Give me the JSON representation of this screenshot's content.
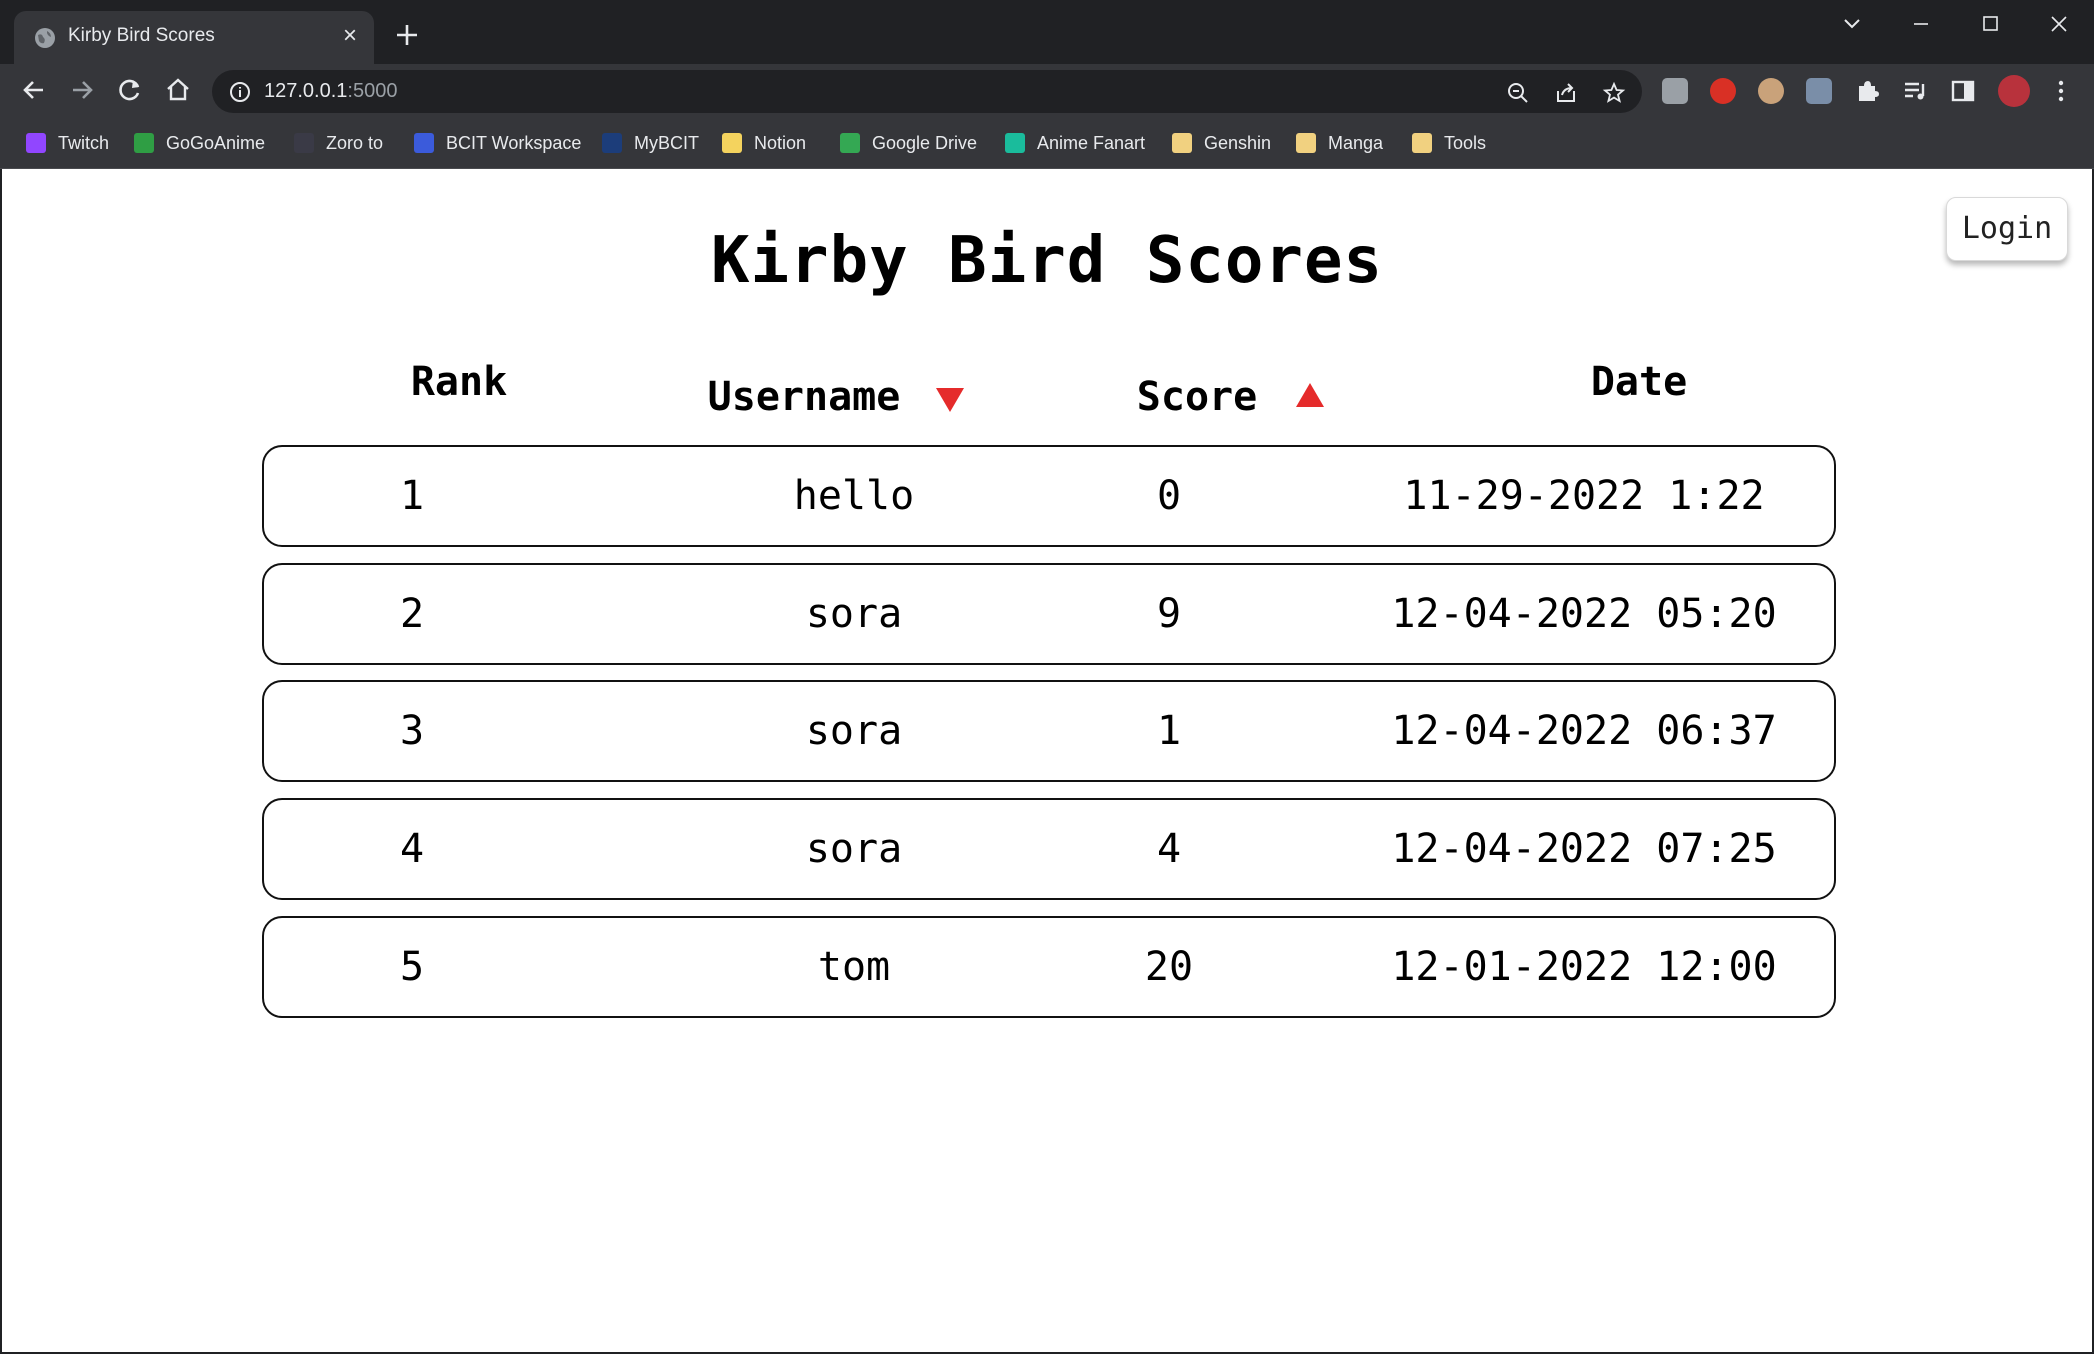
{
  "browser": {
    "tab_title": "Kirby Bird Scores",
    "url_host": "127.0.0.1",
    "url_port": ":5000",
    "bookmarks": [
      {
        "label": "Twitch",
        "color": "#9146ff"
      },
      {
        "label": "GoGoAnime",
        "color": "#2f9e44"
      },
      {
        "label": "Zoro to",
        "color": "#3a3a46"
      },
      {
        "label": "BCIT Workspace",
        "color": "#3b5bdb"
      },
      {
        "label": "MyBCIT",
        "color": "#1c3d7a"
      },
      {
        "label": "Notion",
        "color": "#f4d35e"
      },
      {
        "label": "Google Drive",
        "color": "#34a853"
      },
      {
        "label": "Anime Fanart",
        "color": "#1abc9c"
      },
      {
        "label": "Genshin",
        "color": "#f1d180"
      },
      {
        "label": "Manga",
        "color": "#f1d180"
      },
      {
        "label": "Tools",
        "color": "#f1d180"
      }
    ]
  },
  "page": {
    "title": "Kirby Bird Scores",
    "login_label": "Login",
    "columns": {
      "rank": "Rank",
      "username": "Username",
      "score": "Score",
      "date": "Date"
    },
    "sort_color": "#e52b2b",
    "rows": [
      {
        "rank": "1",
        "username": "hello",
        "score": "0",
        "date": "11-29-2022 1:22"
      },
      {
        "rank": "2",
        "username": "sora",
        "score": "9",
        "date": "12-04-2022 05:20"
      },
      {
        "rank": "3",
        "username": "sora",
        "score": "1",
        "date": "12-04-2022 06:37"
      },
      {
        "rank": "4",
        "username": "sora",
        "score": "4",
        "date": "12-04-2022 07:25"
      },
      {
        "rank": "5",
        "username": "tom",
        "score": "20",
        "date": "12-01-2022 12:00"
      }
    ]
  }
}
